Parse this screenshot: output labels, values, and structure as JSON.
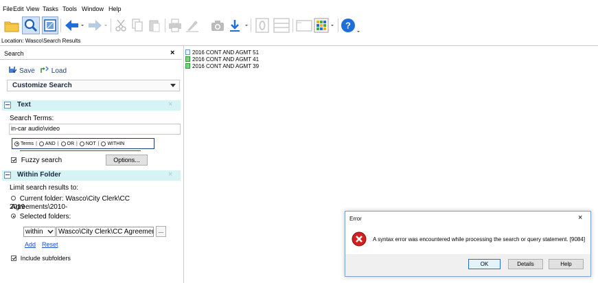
{
  "menu": [
    "File",
    "Edit",
    "View",
    "Tasks",
    "Tools",
    "Window",
    "Help"
  ],
  "toolbar": {
    "icons": [
      "folder-icon",
      "search-icon",
      "panel-icon",
      "back-icon",
      "forward-icon",
      "cut-icon",
      "copy-icon",
      "paste-icon",
      "print-icon",
      "edit-icon",
      "camera-icon",
      "download-icon",
      "record-icon",
      "view-icon",
      "note-icon",
      "grid-icon",
      "help-icon"
    ],
    "accent": "#1e6fd9"
  },
  "location": "Location: Wasco\\Search Results",
  "search_panel": {
    "title": "Search",
    "close": "×",
    "save_label": "Save",
    "load_label": "Load",
    "customize_label": "Customize Search",
    "text_section": {
      "title": "Text",
      "search_terms_label": "Search Terms:",
      "search_terms_value": "in-car audio\\video",
      "options": [
        "Terms",
        "AND",
        "OR",
        "NOT",
        "WITHIN"
      ],
      "selected_option": "Terms",
      "separator": "|",
      "fuzzy_label": "Fuzzy search",
      "fuzzy_checked": true,
      "options_button": "Options..."
    },
    "folder_section": {
      "title": "Within Folder",
      "limit_label": "Limit search results to:",
      "current_folder_line1": "Current folder: Wasco\\City Clerk\\CC Agreements\\2010-",
      "current_folder_line2": "2019",
      "selected_folders_label": "Selected folders:",
      "scope_value": "within",
      "folder_value": "Wasco\\City Clerk\\CC Agreements",
      "browse_label": "...",
      "add_label": "Add",
      "reset_label": "Reset",
      "include_subfolders_label": "Include subfolders",
      "include_subfolders_checked": true
    },
    "section_color": "#d6f4f6"
  },
  "results": [
    {
      "label": "2016 CONT AND AGMT 51",
      "icon": "document-icon",
      "color": "#6b8fd0"
    },
    {
      "label": "2016 CONT AND AGMT 41",
      "icon": "document-icon",
      "color": "#3cb043"
    },
    {
      "label": "2016 CONT AND AGMT 39",
      "icon": "document-icon",
      "color": "#3cb043"
    }
  ],
  "error_dialog": {
    "title": "Error",
    "close": "×",
    "message": "A syntax error was encountered while processing the search or query statement. [9084]",
    "buttons": {
      "ok": "OK",
      "details": "Details",
      "help": "Help"
    },
    "icon": "error-icon",
    "icon_color": "#d02020"
  }
}
